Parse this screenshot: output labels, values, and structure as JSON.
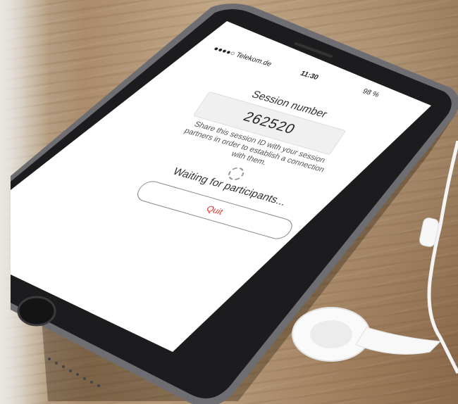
{
  "status_bar": {
    "carrier": "●●●●○ Telekom.de",
    "time": "11:30",
    "battery": "98 %"
  },
  "session": {
    "title": "Session number",
    "number": "262520",
    "description": "Share this session ID with your session partners in order to establish a connection with them.",
    "waiting": "Waiting for participants...",
    "quit_label": "Quit"
  },
  "colors": {
    "quit_text": "#e0302a",
    "phone_body": "#1c1c1e",
    "screen_bg": "#ffffff"
  }
}
